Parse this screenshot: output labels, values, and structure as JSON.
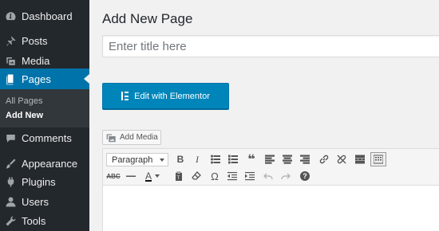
{
  "sidebar": {
    "items": [
      {
        "label": "Dashboard",
        "icon": "dashboard-icon"
      },
      {
        "label": "Posts",
        "icon": "pin-icon"
      },
      {
        "label": "Media",
        "icon": "media-icon"
      },
      {
        "label": "Pages",
        "icon": "pages-icon",
        "active": true
      },
      {
        "label": "Comments",
        "icon": "comments-icon"
      },
      {
        "label": "Appearance",
        "icon": "paintbrush-icon"
      },
      {
        "label": "Plugins",
        "icon": "plugin-icon"
      },
      {
        "label": "Users",
        "icon": "users-icon"
      },
      {
        "label": "Tools",
        "icon": "wrench-icon"
      }
    ],
    "submenu": [
      {
        "label": "All Pages"
      },
      {
        "label": "Add New",
        "current": true
      }
    ],
    "accent_color": "#0073aa"
  },
  "main": {
    "title": "Add New Page",
    "title_placeholder": "Enter title here",
    "elementor_button": "Edit with Elementor",
    "add_media_button": "Add Media",
    "editor": {
      "format_select": "Paragraph",
      "toolbar_row1": [
        "bold-icon",
        "italic-icon",
        "bullet-list-icon",
        "numbered-list-icon",
        "blockquote-icon",
        "align-left-icon",
        "align-center-icon",
        "align-right-icon",
        "link-icon",
        "unlink-icon",
        "read-more-icon",
        "toolbar-toggle-icon"
      ],
      "toolbar_row2": [
        "strikethrough-icon",
        "horizontal-line-icon",
        "text-color-icon",
        "paste-text-icon",
        "clear-formatting-icon",
        "special-character-icon",
        "outdent-icon",
        "indent-icon",
        "undo-icon",
        "redo-icon",
        "help-icon"
      ],
      "bold_glyph": "B",
      "italic_glyph": "I",
      "quote_glyph": "❝",
      "textcolor_glyph": "A",
      "omega_glyph": "Ω",
      "help_glyph": "?"
    }
  }
}
